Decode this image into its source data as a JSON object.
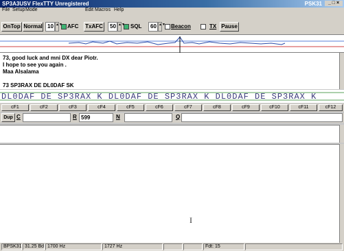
{
  "window": {
    "title": "SP3A3USV FlexTTY    Unregistered",
    "corner": "PSK31",
    "controls": "_ □ ×"
  },
  "menu": [
    "File",
    "Setup",
    "Mode",
    "Edit Macros",
    "Help"
  ],
  "toolbar": {
    "ontop": "OnTop",
    "normal": "Normal",
    "val1": "10",
    "afc": "AFC",
    "txafc": "TxAFC",
    "val2": "50",
    "sql": "SQL",
    "val3": "60",
    "beacon": "Beacon",
    "tx": "TX",
    "pause": "Pause"
  },
  "rx": {
    "lines": [
      "73, good luck and mni DX dear Piotr.",
      "I hope to see you again .",
      "Maa Alsalama",
      "",
      "73 SP3RAX DE DL0DAF SK"
    ]
  },
  "ticker": "DL0DAF DE SP3RAX K  DL0DAF DE SP3RAX K  DL0DAF DE SP3RAX K",
  "fkeys": [
    "cF1",
    "cF2",
    "cF3",
    "cF4",
    "cF5",
    "cF6",
    "cF7",
    "cF8",
    "cF9",
    "cF10",
    "cF11",
    "cF12"
  ],
  "log": {
    "dup": "Dup",
    "c_label": "C",
    "c_value": "",
    "r_label": "R",
    "r_value": "599",
    "n_label": "N",
    "n_value": "",
    "q_label": "Q",
    "q_value": ""
  },
  "status": {
    "mode": "BPSK31",
    "baud": "31.25 Bd",
    "freq1": "1700 Hz",
    "freq2": "1727 Hz",
    "field": "Fdt: 15"
  },
  "cursor": "I"
}
